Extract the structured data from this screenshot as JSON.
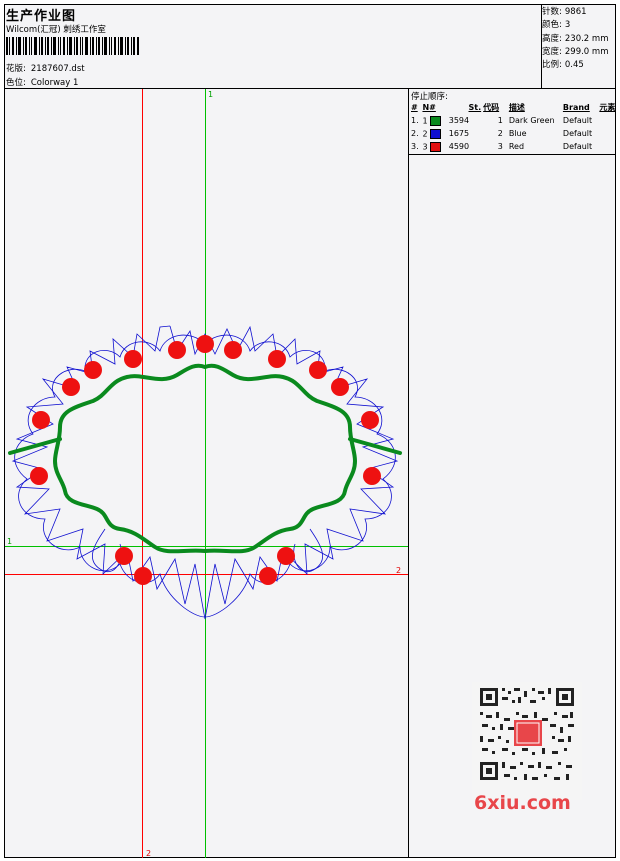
{
  "header": {
    "title": "生产作业图",
    "subtitle": "Wilcom(汇冠) 刺绣工作室",
    "design_label": "花版:",
    "design_value": "2187607.dst",
    "colorway_label": "色位:",
    "colorway_value": "Colorway 1"
  },
  "stats": [
    {
      "label": "针数:",
      "value": "9861"
    },
    {
      "label": "颜色:",
      "value": "3"
    },
    {
      "label": "高度:",
      "value": "230.2 mm"
    },
    {
      "label": "宽度:",
      "value": "299.0 mm"
    },
    {
      "label": "比例:",
      "value": "0.45"
    }
  ],
  "stop_sequence": {
    "title": "停止顺序:",
    "headers": [
      "#",
      "N#",
      "St.",
      "代码",
      "描述",
      "Brand",
      "元素"
    ],
    "rows": [
      {
        "index": "1.",
        "n": "1",
        "color": "#0a8a1e",
        "stitches": "3594",
        "code": "1",
        "description": "Dark Green",
        "brand": "Default"
      },
      {
        "index": "2.",
        "n": "2",
        "color": "#1010d0",
        "stitches": "1675",
        "code": "2",
        "description": "Blue",
        "brand": "Default"
      },
      {
        "index": "3.",
        "n": "3",
        "color": "#e01010",
        "stitches": "4590",
        "code": "3",
        "description": "Red",
        "brand": "Default"
      }
    ]
  },
  "axes": {
    "v_green_label": "1",
    "h_green_label": "1",
    "h_red_label": "2",
    "v_red_label": "2"
  },
  "watermark": "6xiu.com"
}
